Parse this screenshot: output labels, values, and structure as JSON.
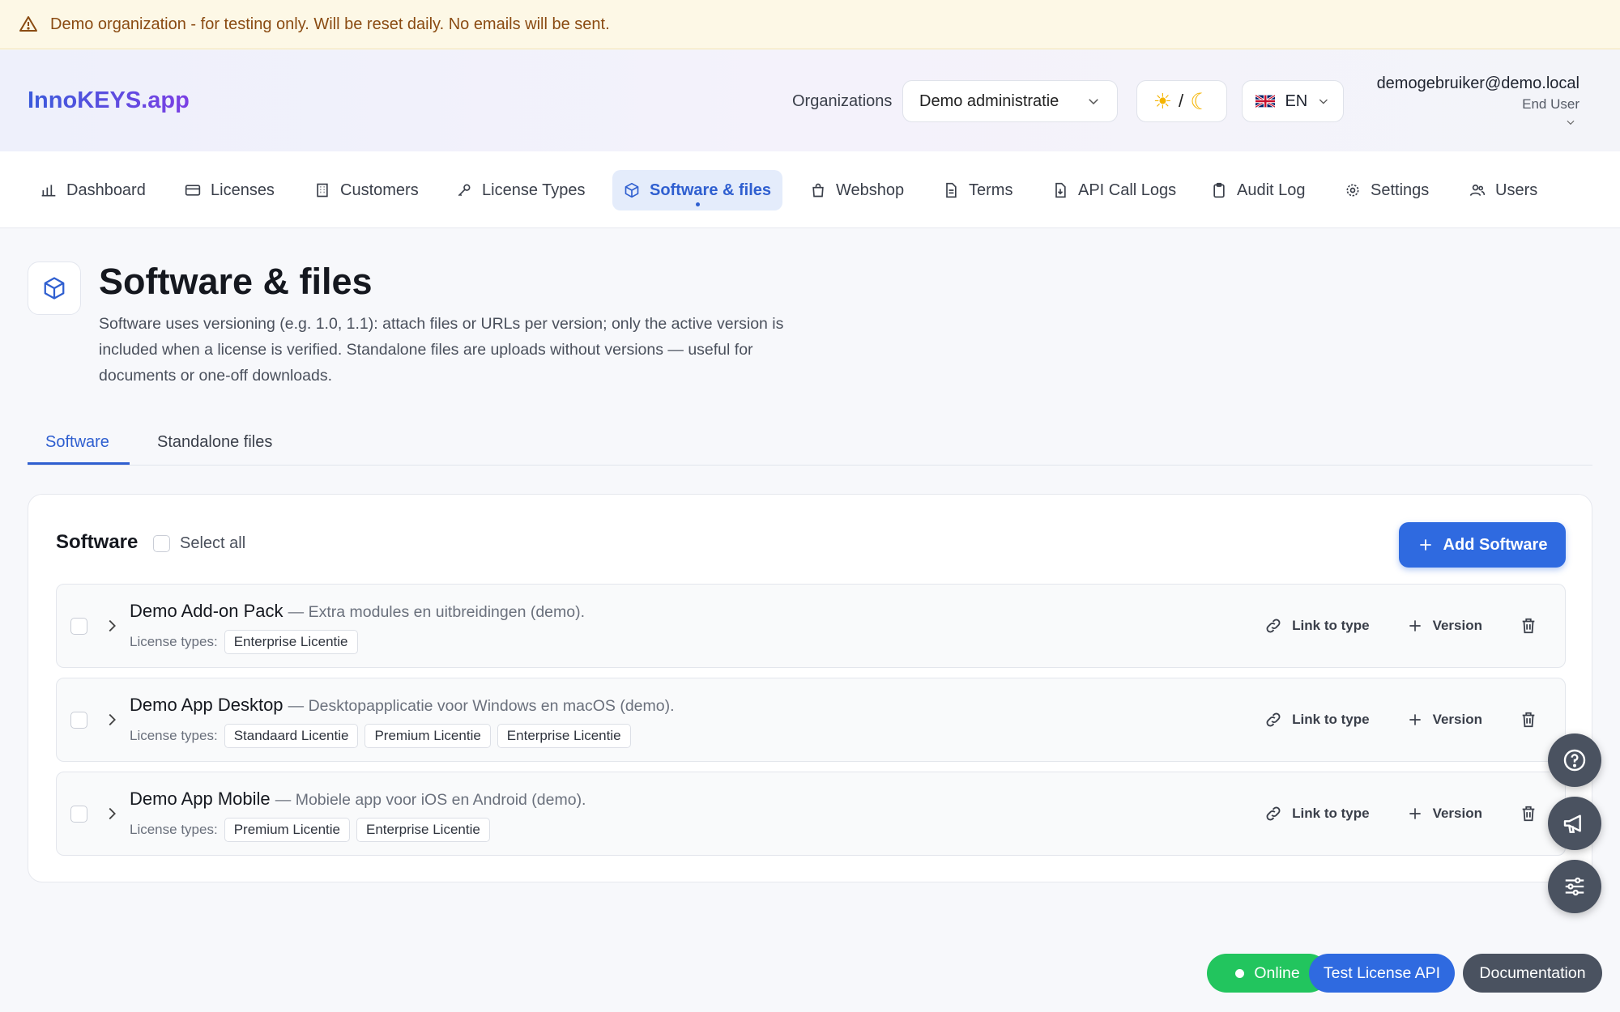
{
  "banner": {
    "text": "Demo organization - for testing only. Will be reset daily. No emails will be sent.",
    "icon": "warning-triangle-icon"
  },
  "header": {
    "logo": "InnoKEYS.app",
    "org_label": "Organizations",
    "org_value": "Demo administratie",
    "theme_toggle": {
      "sun": "☀",
      "sep": "/",
      "moon": "☾"
    },
    "language": "EN",
    "user_email": "demogebruiker@demo.local",
    "user_role": "End User"
  },
  "nav": {
    "items": [
      {
        "label": "Dashboard",
        "icon": "bar-chart-icon"
      },
      {
        "label": "Licenses",
        "icon": "credit-card-icon"
      },
      {
        "label": "Customers",
        "icon": "building-icon"
      },
      {
        "label": "License Types",
        "icon": "key-icon"
      },
      {
        "label": "Software & files",
        "icon": "box-icon",
        "active": true
      },
      {
        "label": "Webshop",
        "icon": "shopping-bag-icon"
      },
      {
        "label": "Terms",
        "icon": "file-text-icon"
      },
      {
        "label": "API Call Logs",
        "icon": "file-download-icon"
      },
      {
        "label": "Audit Log",
        "icon": "clipboard-icon"
      },
      {
        "label": "Settings",
        "icon": "gear-icon"
      },
      {
        "label": "Users",
        "icon": "users-icon"
      }
    ]
  },
  "page": {
    "title": "Software & files",
    "description": "Software uses versioning (e.g. 1.0, 1.1): attach files or URLs per version; only the active version is included when a license is verified. Standalone files are uploads without versions — useful for documents or one-off downloads."
  },
  "tabs": [
    {
      "label": "Software",
      "active": true
    },
    {
      "label": "Standalone files"
    }
  ],
  "software_card": {
    "title": "Software",
    "select_all": "Select all",
    "add_button": "Add Software",
    "license_types_label": "License types:",
    "action_link": "Link to type",
    "action_version": "Version",
    "items": [
      {
        "name": "Demo Add-on Pack",
        "description": "— Extra modules en uitbreidingen (demo).",
        "types": [
          "Enterprise Licentie"
        ]
      },
      {
        "name": "Demo App Desktop",
        "description": "— Desktopapplicatie voor Windows en macOS (demo).",
        "types": [
          "Standaard Licentie",
          "Premium Licentie",
          "Enterprise Licentie"
        ]
      },
      {
        "name": "Demo App Mobile",
        "description": "— Mobiele app voor iOS en Android (demo).",
        "types": [
          "Premium Licentie",
          "Enterprise Licentie"
        ]
      }
    ]
  },
  "footer": {
    "status": "Online",
    "test_api": "Test License API",
    "docs": "Documentation"
  },
  "colors": {
    "accent": "#2f6ae0",
    "online": "#22c55e",
    "banner_bg": "#fdf8e6",
    "banner_text": "#8a4b12"
  }
}
